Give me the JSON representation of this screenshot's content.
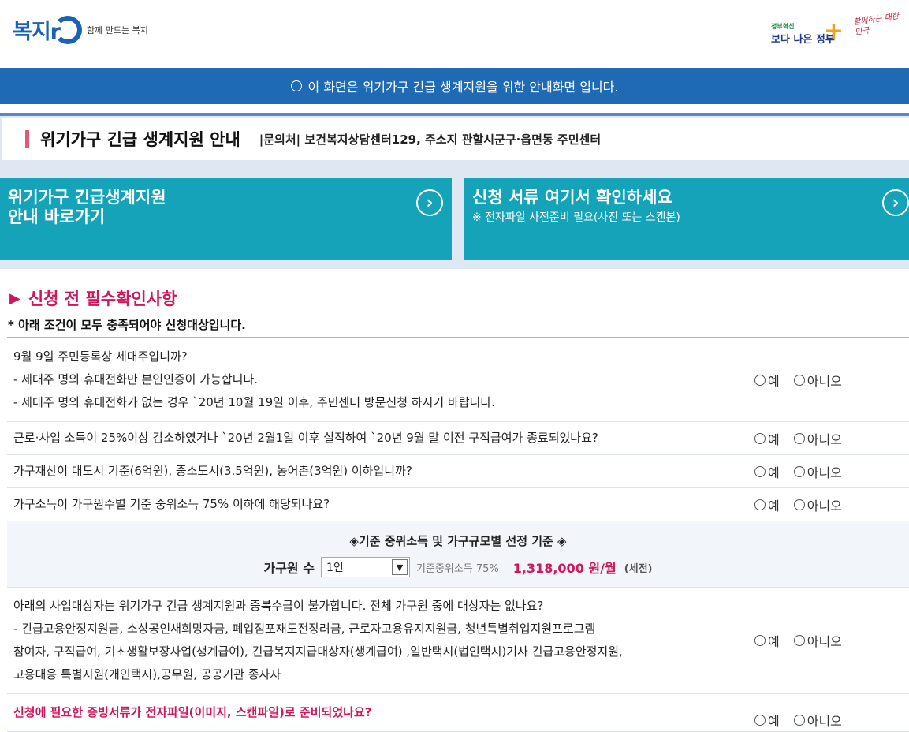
{
  "header": {
    "logo_text": "복지r",
    "logo_tagline": "함께 만드는 복지",
    "gov_small": "정부혁신",
    "gov_big": "보다 나은 정부",
    "slogan": "함께하는 대한민국"
  },
  "notice": {
    "icon": "info-icon",
    "text": "이 화면은 위기가구 긴급 생계지원을 위한 안내화면 입니다."
  },
  "title": {
    "main": "위기가구 긴급 생계지원 안내",
    "contact": "|문의처| 보건복지상담센터129, 주소지 관할시군구·읍면동 주민센터"
  },
  "tiles": [
    {
      "title_line1": "위기가구 긴급생계지원",
      "title_line2": "안내 바로가기",
      "sub": ""
    },
    {
      "title_line1": "신청 서류 여기서 확인하세요",
      "title_line2": "",
      "sub": "※ 전자파일 사전준비 필요(사진 또는 스캔본)"
    }
  ],
  "section": {
    "title": "신청 전 필수확인사항",
    "note": "* 아래 조건이 모두 충족되어야 신청대상입니다."
  },
  "options": {
    "yes": "예",
    "no": "아니오"
  },
  "questions": [
    {
      "lines": [
        "9월 9일 주민등록상 세대주입니까?",
        "- 세대주 명의 휴대전화만 본인인증이 가능합니다.",
        "- 세대주 명의 휴대전화가 없는 경우 `20년 10월 19일 이후, 주민센터 방문신청 하시기 바랍니다."
      ]
    },
    {
      "lines": [
        "근로·사업 소득이 25%이상 감소하였거나 `20년 2월1일 이후 실직하여 `20년 9월 말 이전 구직급여가 종료되었나요?"
      ]
    },
    {
      "lines": [
        "가구재산이 대도시 기준(6억원), 중소도시(3.5억원), 농어촌(3억원) 이하입니까?"
      ]
    },
    {
      "lines": [
        "가구소득이 가구원수별 기준 중위소득 75% 이하에 해당되나요?"
      ]
    }
  ],
  "criteria": {
    "title": "◈기준 중위소득 및 가구규모별 선정 기준 ◈",
    "household_label": "가구원 수",
    "household_value": "1인",
    "base_label": "기준중위소득 75%",
    "amount": "1,318,000 원/월",
    "tax": "(세전)"
  },
  "questions2": [
    {
      "lines": [
        "아래의 사업대상자는 위기가구 긴급 생계지원과 중복수급이 불가합니다. 전체 가구원 중에 대상자는 없나요?",
        "- 긴급고용안정지원금, 소상공인새희망자금, 폐업점포재도전장려금, 근로자고용유지지원금, 청년특별취업지원프로그램",
        "참여자, 구직급여, 기초생활보장사업(생계급여), 긴급복지지급대상자(생계급여) ,일반택시(법인택시)기사 긴급고용안정지원,",
        "고용대응 특별지원(개인택시),공무원, 공공기관 종사자"
      ]
    },
    {
      "lines": [
        "신청에 필요한 증빙서류가 전자파일(이미지, 스캔파일)로 준비되었나요?"
      ]
    }
  ]
}
